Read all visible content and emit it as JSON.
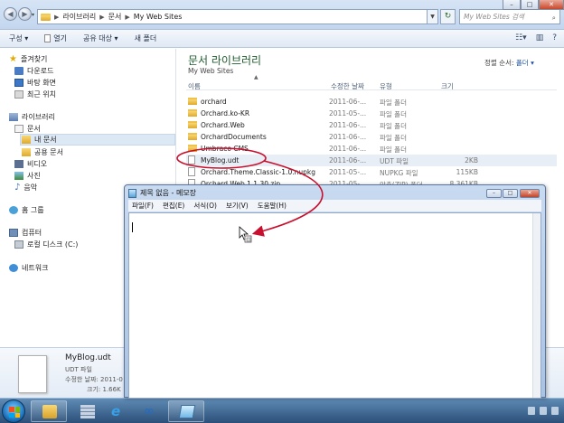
{
  "explorer": {
    "breadcrumb": [
      "라이브러리",
      "문서",
      "My Web Sites"
    ],
    "search_placeholder": "My Web Sites 검색",
    "toolbar": {
      "organize": "구성 ▾",
      "open": "열기",
      "share": "공유 대상 ▾",
      "new_folder": "새 폴더"
    },
    "sidebar": {
      "favorites": "즐겨찾기",
      "downloads": "다운로드",
      "desktop": "바탕 화면",
      "recent": "최근 위치",
      "libraries": "라이브러리",
      "documents": "문서",
      "my_documents": "내 문서",
      "public_documents": "공용 문서",
      "videos": "비디오",
      "pictures": "사진",
      "music": "음악",
      "homegroup": "홈 그룹",
      "computer": "컴퓨터",
      "local_disk": "로컬 디스크 (C:)",
      "network": "네트워크"
    },
    "library_title": "문서 라이브러리",
    "library_subtitle": "My Web Sites",
    "arrange_label": "정렬 순서:",
    "arrange_value": "폴더 ▾",
    "columns": {
      "name": "이름",
      "date": "수정한 날짜",
      "type": "유형",
      "size": "크기"
    },
    "files": [
      {
        "name": "orchard",
        "date": "2011-06-...",
        "type": "파일 폴더",
        "size": "",
        "kind": "folder"
      },
      {
        "name": "Orchard.ko-KR",
        "date": "2011-05-...",
        "type": "파일 폴더",
        "size": "",
        "kind": "folder"
      },
      {
        "name": "Orchard.Web",
        "date": "2011-06-...",
        "type": "파일 폴더",
        "size": "",
        "kind": "folder"
      },
      {
        "name": "OrchardDocuments",
        "date": "2011-06-...",
        "type": "파일 폴더",
        "size": "",
        "kind": "folder"
      },
      {
        "name": "Umbraco CMS",
        "date": "2011-06-...",
        "type": "파일 폴더",
        "size": "",
        "kind": "folder"
      },
      {
        "name": "MyBlog.udt",
        "date": "2011-06-...",
        "type": "UDT 파일",
        "size": "2KB",
        "kind": "file"
      },
      {
        "name": "Orchard.Theme.Classic-1.0.nupkg",
        "date": "2011-05-...",
        "type": "NUPKG 파일",
        "size": "115KB",
        "kind": "file"
      },
      {
        "name": "Orchard.Web.1.1.30.zip",
        "date": "2011-05-...",
        "type": "압축(ZIP) 폴더",
        "size": "8,361KB",
        "kind": "file"
      }
    ],
    "details": {
      "name": "MyBlog.udt",
      "type": "UDT 파일",
      "modified_label": "수정한 날짜:",
      "modified_value": "2011-0",
      "size_label": "크기:",
      "size_value": "1.66K"
    }
  },
  "notepad": {
    "title": "제목 없음 - 메모장",
    "menu": [
      "파일(F)",
      "편집(E)",
      "서식(O)",
      "보기(V)",
      "도움말(H)"
    ]
  },
  "colors": {
    "annotation_red": "#c8102e",
    "library_title": "#1e5a2d",
    "taskbar": "#2b4f78"
  }
}
